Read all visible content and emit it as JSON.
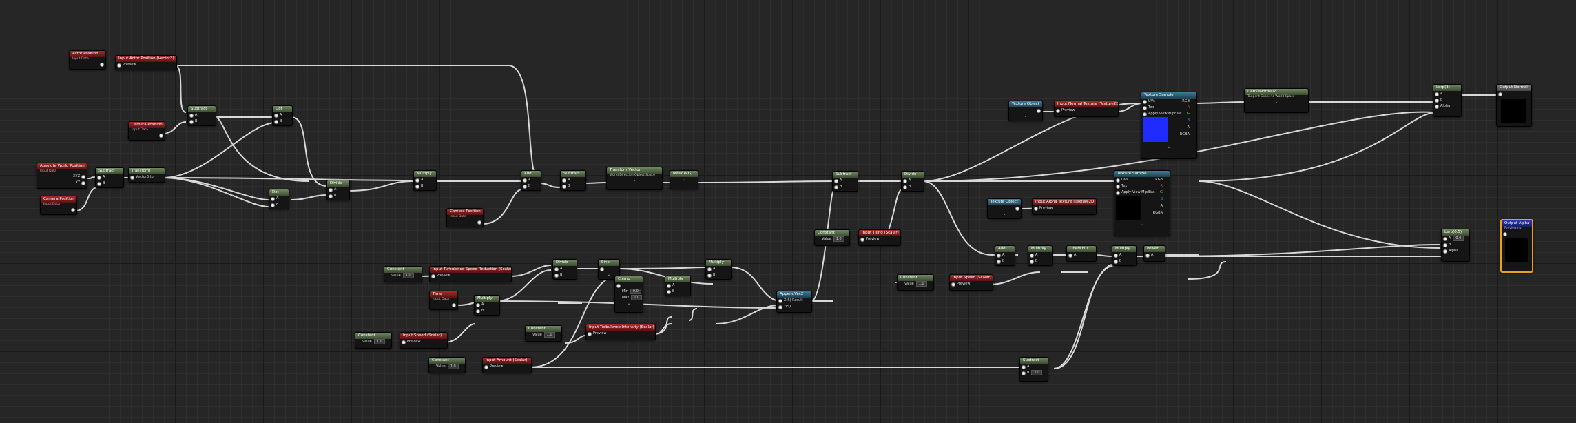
{
  "nodes": {
    "actor_position": {
      "title": "Actor Position",
      "subtitle": "Input Data"
    },
    "input_actor_position": {
      "title": "Input Actor Position (Vector3)",
      "preview": "Preview"
    },
    "camera_position_1": {
      "title": "Camera Position",
      "subtitle": "Input Data"
    },
    "absolute_world_position": {
      "title": "Absolute World Position",
      "subtitle": "Input Data",
      "pin_xyz": "XYZ",
      "pin_xy": "XY"
    },
    "camera_position_2": {
      "title": "Camera Position",
      "subtitle": "Input Data"
    },
    "subtract_1": {
      "title": "Subtract",
      "pin_a": "A",
      "pin_b": "B"
    },
    "subtract_2": {
      "title": "Subtract",
      "pin_a": "A",
      "pin_b": "B"
    },
    "transform": {
      "title": "Transform",
      "label": "Vector3 to",
      "value": "Vector Data"
    },
    "dot_1": {
      "title": "Dot",
      "pin_a": "A",
      "pin_b": "B"
    },
    "dot_2": {
      "title": "Dot",
      "pin_a": "A",
      "pin_b": "B"
    },
    "divide_1": {
      "title": "Divide",
      "pin_a": "A",
      "pin_b": "B"
    },
    "multiply_1": {
      "title": "Multiply",
      "pin_a": "A",
      "pin_b": "B"
    },
    "camera_position_3": {
      "title": "Camera Position",
      "subtitle": "Input Data"
    },
    "add_1": {
      "title": "Add",
      "pin_a": "A",
      "pin_b": "B"
    },
    "subtract_3": {
      "title": "Subtract",
      "pin_a": "A",
      "pin_b": "B"
    },
    "swizzle": {
      "title": "TransformVector",
      "subtitle": "World Direction Object Space"
    },
    "mask": {
      "title": "Mask (RG)"
    },
    "subtract_4": {
      "title": "Subtract",
      "pin_a": "A",
      "pin_b": "B"
    },
    "divide_2": {
      "title": "Divide",
      "pin_a": "A",
      "pin_b": "B"
    },
    "constant_tiling": {
      "title": "Constant",
      "value_label": "Value",
      "value": "1.0"
    },
    "input_tiling": {
      "title": "Input Tiling (Scalar)",
      "preview": "Preview"
    },
    "texture_object_1": {
      "title": "Texture Object"
    },
    "input_normal_texture": {
      "title": "Input Normal Texture (Texture2D)",
      "preview": "Preview"
    },
    "texture_sample_1": {
      "title": "Texture Sample",
      "pins_in": [
        "UVs",
        "Tex",
        "Apply View MipBias"
      ],
      "pins_out": [
        "RGB",
        "R",
        "G",
        "B",
        "A",
        "RGBA"
      ]
    },
    "transform_normal": {
      "title": "DeriveNormalZ",
      "subtitle": "Tangent Space to World Space"
    },
    "texture_object_2": {
      "title": "Texture Object"
    },
    "input_alpha_texture": {
      "title": "Input Alpha Texture (Texture2D)",
      "preview": "Preview"
    },
    "texture_sample_2": {
      "title": "Texture Sample",
      "pins_in": [
        "UVs",
        "Tex",
        "Apply View MipBias"
      ],
      "pins_out": [
        "RGB",
        "R",
        "G",
        "B",
        "A",
        "RGBA"
      ]
    },
    "lerp_top": {
      "title": "Lerp(3)",
      "pins_in": [
        "A",
        "B",
        "Alpha"
      ]
    },
    "output_normal": {
      "title": "Output Normal"
    },
    "lerp_bottom": {
      "title": "Lerp(0.5)",
      "pins_in": [
        "A",
        "B",
        "Alpha"
      ],
      "a_value": "0.0"
    },
    "output_alpha": {
      "title": "Output Alpha",
      "subtitle": "Previewing"
    },
    "constant_speed_red": {
      "title": "Constant",
      "value_label": "Value",
      "value": "1.0"
    },
    "input_turb_speed_reduction": {
      "title": "Input Turbulence Speed Reduction (Scalar)",
      "preview": "Preview"
    },
    "time": {
      "title": "Time",
      "subtitle": "Input Data"
    },
    "multiply_time": {
      "title": "Multiply",
      "pin_a": "A",
      "pin_b": "B"
    },
    "divide_3": {
      "title": "Divide",
      "pin_a": "A",
      "pin_b": "B"
    },
    "sine": {
      "title": "Sine"
    },
    "multiply_2": {
      "title": "Multiply",
      "pin_a": "A",
      "pin_b": "B"
    },
    "clamp": {
      "title": "Clamp",
      "min_label": "Min",
      "min_value": "0.0",
      "max_label": "Max",
      "max_value": "1.0"
    },
    "multiply_3": {
      "title": "Multiply",
      "pin_a": "A",
      "pin_b": "B"
    },
    "append": {
      "title": "AppendVec2",
      "pin_x": "X(S) Result",
      "pin_y": "Y(S)"
    },
    "constant_speed": {
      "title": "Constant",
      "value_label": "Value",
      "value": "1.0"
    },
    "input_speed": {
      "title": "Input Speed (Scalar)",
      "preview": "Preview"
    },
    "constant_turb_intensity": {
      "title": "Constant",
      "value_label": "Value",
      "value": "1.0"
    },
    "input_turb_intensity": {
      "title": "Input Turbulence Intensity (Scalar)",
      "preview": "Preview"
    },
    "constant_amount": {
      "title": "Constant",
      "value_label": "Value",
      "value": "1.0"
    },
    "input_amount": {
      "title": "Input Amount (Scalar)",
      "preview": "Preview"
    },
    "constant_speed2": {
      "title": "Constant",
      "value_label": "Value",
      "value": "1.0"
    },
    "input_speed2": {
      "title": "Input Speed (Scalar)",
      "preview": "Preview"
    },
    "add_2": {
      "title": "Add",
      "pin_a": "A",
      "pin_b": "B"
    },
    "multiply_4": {
      "title": "Multiply",
      "pin_a": "A",
      "pin_b": "B"
    },
    "oneminus": {
      "title": "OneMinus",
      "pin_a": "A"
    },
    "multiply_5": {
      "title": "Multiply",
      "pin_a": "A",
      "pin_b": "B"
    },
    "power": {
      "title": "Power",
      "pin_a": "A",
      "pin_b": "B"
    },
    "subtract_bottom": {
      "title": "Subtract",
      "pin_a": "A",
      "pin_b": "B",
      "b_value": "1.0"
    }
  },
  "colors": {
    "graph_bg": "#262626",
    "wire": "#d8d8d8",
    "input_header": "#a82a2a",
    "math_header": "#6f8a5e",
    "texture_header": "#3c7d96",
    "blue_preview": "#1f2bff",
    "selection": "#e8a020"
  }
}
